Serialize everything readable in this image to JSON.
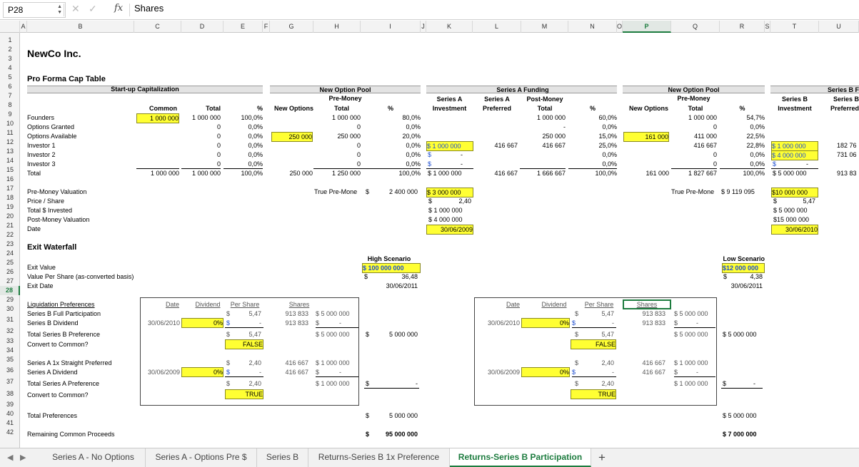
{
  "formula_bar": {
    "name_box": "P28",
    "formula": "Shares"
  },
  "columns": [
    "A",
    "B",
    "C",
    "D",
    "E",
    "F",
    "G",
    "H",
    "I",
    "J",
    "K",
    "L",
    "M",
    "N",
    "O",
    "P",
    "Q",
    "R",
    "S",
    "T",
    "U"
  ],
  "selected_column": "P",
  "rows": [
    "1",
    "2",
    "3",
    "4",
    "5",
    "6",
    "7",
    "8",
    "9",
    "10",
    "11",
    "12",
    "13",
    "14",
    "15",
    "16",
    "17",
    "18",
    "19",
    "20",
    "21",
    "22",
    "23",
    "24",
    "25",
    "26",
    "27",
    "28",
    "29",
    "30",
    "31",
    "32",
    "33",
    "34",
    "35",
    "36",
    "37",
    "38",
    "39",
    "40",
    "41",
    "42"
  ],
  "selected_row": "28",
  "sheet": {
    "company": "NewCo Inc.",
    "cap_table_title": "Pro Forma Cap Table",
    "startup_cap": "Start-up Capitalization",
    "new_option_pool": "New Option Pool",
    "pre_money": "Pre-Money",
    "series_a_funding": "Series A Funding",
    "series_a": "Series A",
    "investment": "Investment",
    "preferred": "Preferred",
    "post_money": "Post-Money",
    "series_b": "Series B",
    "series_b_f": "Series B F",
    "col_common": "Common",
    "col_total": "Total",
    "col_pct": "%",
    "col_new_options": "New Options",
    "row_labels": [
      "Founders",
      "Options Granted",
      "Options Available",
      "Investor 1",
      "Investor 2",
      "Investor 3",
      "Total"
    ],
    "common": [
      "1 000 000",
      "",
      "",
      "",
      "",
      "",
      "1 000 000"
    ],
    "total": [
      "1 000 000",
      "0",
      "0",
      "0",
      "0",
      "0",
      "1 000 000"
    ],
    "pct1": [
      "100,0%",
      "0,0%",
      "0,0%",
      "0,0%",
      "0,0%",
      "0,0%",
      "100,0%"
    ],
    "new_options_1": [
      "",
      "",
      "250 000",
      "",
      "",
      "",
      "250 000"
    ],
    "pre_total_1": [
      "1 000 000",
      "0",
      "250 000",
      "0",
      "0",
      "0",
      "1 250 000"
    ],
    "pct2": [
      "80,0%",
      "0,0%",
      "20,0%",
      "0,0%",
      "0,0%",
      "0,0%",
      "100,0%"
    ],
    "sa_investment": [
      "",
      "",
      "",
      "$ 1 000 000",
      "$",
      "$",
      "$ 1 000 000"
    ],
    "sa_investment_dash": [
      "",
      "",
      "",
      "",
      "-",
      "-",
      ""
    ],
    "sa_preferred": [
      "",
      "",
      "",
      "416 667",
      "",
      "",
      "416 667"
    ],
    "post_total": [
      "1 000 000",
      "-",
      "250 000",
      "416 667",
      "",
      "",
      "1 666 667"
    ],
    "pct3": [
      "60,0%",
      "0,0%",
      "15,0%",
      "25,0%",
      "0,0%",
      "0,0%",
      "100,0%"
    ],
    "new_options_2": [
      "",
      "",
      "161 000",
      "",
      "",
      "",
      "161 000"
    ],
    "pre_total_2": [
      "1 000 000",
      "0",
      "411 000",
      "416 667",
      "0",
      "0",
      "1 827 667"
    ],
    "pct4": [
      "54,7%",
      "0,0%",
      "22,5%",
      "22,8%",
      "0,0%",
      "0,0%",
      "100,0%"
    ],
    "sb_investment": [
      "",
      "",
      "",
      "$ 1 000 000",
      "$ 4 000 000",
      "$",
      "$ 5 000 000"
    ],
    "sb_investment_dash": [
      "",
      "",
      "",
      "",
      "",
      "-",
      ""
    ],
    "sb_pref": [
      "",
      "",
      "",
      "182 76",
      "731 06",
      "",
      "913 83"
    ],
    "val_labels": [
      "Pre-Money Valuation",
      "Price / Share",
      "Total $ Invested",
      "Post-Money Valuation",
      "Date"
    ],
    "true_pre_money_a": "True Pre-Mone",
    "true_pre_money_a_val": "$",
    "true_pre_money_a_num": "2 400 000",
    "sa_vals": [
      "$ 3 000 000",
      "$",
      "$ 1 000 000",
      "$ 4 000 000",
      "30/06/2009"
    ],
    "sa_price": "2,40",
    "true_pre_money_b": "True Pre-Mone",
    "true_pre_money_b_val": "$ 9 119 095",
    "sb_vals": [
      "$10 000 000",
      "$",
      "$ 5 000 000",
      "$15 000 000",
      "30/06/2010"
    ],
    "sb_price": "5,47",
    "exit_title": "Exit Waterfall",
    "high_scenario": "High Scenario",
    "low_scenario": "Low Scenario",
    "exit_labels": [
      "Exit Value",
      "Value Per Share (as-converted basis)",
      "Exit Date"
    ],
    "high_exit_value": "$   100 000 000",
    "high_vps_dollar": "$",
    "high_vps": "36,48",
    "high_date": "30/06/2011",
    "low_exit_value": "$12 000 000",
    "low_vps_dollar": "$",
    "low_vps": "4,38",
    "low_date": "30/06/2011",
    "waterfall_labels": {
      "liq": "Liquidation Preferences",
      "sbfp": "Series B Full Participation",
      "sbdiv": "Series B Dividend",
      "tsbp": "Total Series B Preference",
      "conv": "Convert to Common?",
      "sa1x": "Series A 1x Straight Preferred",
      "sadiv": "Series A Dividend",
      "tsap": "Total Series A Preference",
      "conv2": "Convert to Common?",
      "total_pref": "Total Preferences",
      "remaining": "Remaining Common Proceeds"
    },
    "wf_headers": {
      "date": "Date",
      "dividend": "Dividend",
      "per_share": "Per Share",
      "shares": "Shares"
    },
    "wf": {
      "sb_per_share": "5,47",
      "sb_shares": "913 833",
      "sb_amount": "$ 5 000 000",
      "sb_div_date": "30/06/2010",
      "sb_div_pct": "0%",
      "sb_div_shares": "913 833",
      "sb_div_amount": "$",
      "dash": "-",
      "sb_total_ps": "5,47",
      "sb_total": "$ 5 000 000",
      "sb_conv": "FALSE",
      "sa_per_share": "2,40",
      "sa_shares": "416 667",
      "sa_amount": "$ 1 000 000",
      "sa_div_date": "30/06/2009",
      "sa_div_pct": "0%",
      "sa_div_shares": "416 667",
      "sa_div_amount": "$",
      "sa_total_ps": "2,40",
      "sa_total": "$ 1 000 000",
      "sa_conv": "TRUE",
      "dollar": "$"
    },
    "high_totals": {
      "sb": "5 000 000",
      "sa": "-",
      "total_pref": "5 000 000",
      "remaining": "95 000 000"
    },
    "low_totals": {
      "sb": "$ 5 000 000",
      "sa": "-",
      "total_pref": "$ 5 000 000",
      "remaining": "$ 7 000 000"
    }
  },
  "tabs": [
    "Series A - No Options",
    "Series A - Options Pre $",
    "Series B",
    "Returns-Series B 1x Preference",
    "Returns-Series B Participation"
  ],
  "active_tab": "Returns-Series B Participation",
  "colors": {
    "accent": "#1d7c3f",
    "highlight": "#ffff33",
    "link_blue": "#1f4fd0"
  }
}
